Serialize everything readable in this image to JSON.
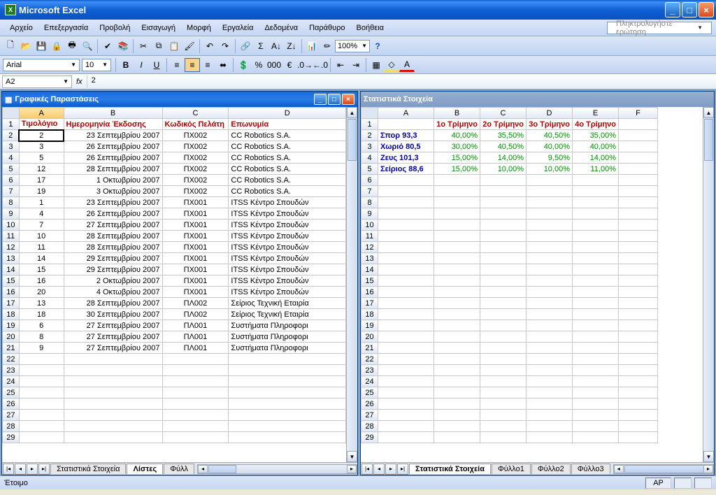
{
  "app": {
    "title": "Microsoft Excel"
  },
  "menu": [
    "Αρχείο",
    "Επεξεργασία",
    "Προβολή",
    "Εισαγωγή",
    "Μορφή",
    "Εργαλεία",
    "Δεδομένα",
    "Παράθυρο",
    "Βοήθεια"
  ],
  "helpbox_placeholder": "Πληκτρολογήστε ερώτηση",
  "zoom": "100%",
  "font": {
    "name": "Arial",
    "size": "10"
  },
  "namebox": "A2",
  "formula": "2",
  "child_left": {
    "title": "Γραφικές Παραστάσεις",
    "tabs": [
      "Στατιστικά Στοιχεία",
      "Λίστες",
      "Φύλλ"
    ],
    "active_tab": 1,
    "cols": [
      "A",
      "B",
      "C",
      "D"
    ],
    "headers": [
      "Τιμολόγιo",
      "Ημερομηνία Έκδοσης",
      "Κωδικός Πελάτη",
      "Επωνυμία"
    ],
    "rows": [
      [
        "2",
        "23 Σεπτεμβρίου 2007",
        "ΠΧ002",
        "CC Robotics S.A."
      ],
      [
        "3",
        "26 Σεπτεμβρίου 2007",
        "ΠΧ002",
        "CC Robotics S.A."
      ],
      [
        "5",
        "26 Σεπτεμβρίου 2007",
        "ΠΧ002",
        "CC Robotics S.A."
      ],
      [
        "12",
        "28 Σεπτεμβρίου 2007",
        "ΠΧ002",
        "CC Robotics S.A."
      ],
      [
        "17",
        "1 Οκτωβρίου 2007",
        "ΠΧ002",
        "CC Robotics S.A."
      ],
      [
        "19",
        "3 Οκτωβρίου 2007",
        "ΠΧ002",
        "CC Robotics S.A."
      ],
      [
        "1",
        "23 Σεπτεμβρίου 2007",
        "ΠΧ001",
        "ITSS Κέντρο Σπουδών"
      ],
      [
        "4",
        "26 Σεπτεμβρίου 2007",
        "ΠΧ001",
        "ITSS Κέντρο Σπουδών"
      ],
      [
        "7",
        "27 Σεπτεμβρίου 2007",
        "ΠΧ001",
        "ITSS Κέντρο Σπουδών"
      ],
      [
        "10",
        "28 Σεπτεμβρίου 2007",
        "ΠΧ001",
        "ITSS Κέντρο Σπουδών"
      ],
      [
        "11",
        "28 Σεπτεμβρίου 2007",
        "ΠΧ001",
        "ITSS Κέντρο Σπουδών"
      ],
      [
        "14",
        "29 Σεπτεμβρίου 2007",
        "ΠΧ001",
        "ITSS Κέντρο Σπουδών"
      ],
      [
        "15",
        "29 Σεπτεμβρίου 2007",
        "ΠΧ001",
        "ITSS Κέντρο Σπουδών"
      ],
      [
        "16",
        "2 Οκτωβρίου 2007",
        "ΠΧ001",
        "ITSS Κέντρο Σπουδών"
      ],
      [
        "20",
        "4 Οκτωβρίου 2007",
        "ΠΧ001",
        "ITSS Κέντρο Σπουδών"
      ],
      [
        "13",
        "28 Σεπτεμβρίου 2007",
        "ΠΛ002",
        "Σείριος Τεχνική Εταιρία"
      ],
      [
        "18",
        "30 Σεπτεμβρίου 2007",
        "ΠΛ002",
        "Σείριος Τεχνική Εταιρία"
      ],
      [
        "6",
        "27 Σεπτεμβρίου 2007",
        "ΠΛ001",
        "Συστήματα Πληροφορι"
      ],
      [
        "8",
        "27 Σεπτεμβρίου 2007",
        "ΠΛ001",
        "Συστήματα Πληροφορι"
      ],
      [
        "9",
        "27 Σεπτεμβρίου 2007",
        "ΠΛ001",
        "Συστήματα Πληροφορι"
      ]
    ]
  },
  "child_right": {
    "title": "Στατιστικά Στοιχεία",
    "tabs": [
      "Στατιστικά Στοιχεία",
      "Φύλλο1",
      "Φύλλο2",
      "Φύλλο3"
    ],
    "active_tab": 0,
    "cols": [
      "A",
      "B",
      "C",
      "D",
      "E",
      "F"
    ],
    "headers": [
      "",
      "1ο Τρίμηνο",
      "2ο Τρίμηνο",
      "3ο Τρίμηνο",
      "4ο Τρίμηνο",
      ""
    ],
    "rows": [
      [
        "Σπορ 93,3",
        "40,00%",
        "35,50%",
        "40,50%",
        "35,00%",
        ""
      ],
      [
        "Χωριό 80,5",
        "30,00%",
        "40,50%",
        "40,00%",
        "40,00%",
        ""
      ],
      [
        "Ζευς 101,3",
        "15,00%",
        "14,00%",
        "9,50%",
        "14,00%",
        ""
      ],
      [
        "Σείριος 88,6",
        "15,00%",
        "10,00%",
        "10,00%",
        "11,00%",
        ""
      ]
    ]
  },
  "status": {
    "ready": "Έτοιμο",
    "ap": "ΑΡ"
  }
}
